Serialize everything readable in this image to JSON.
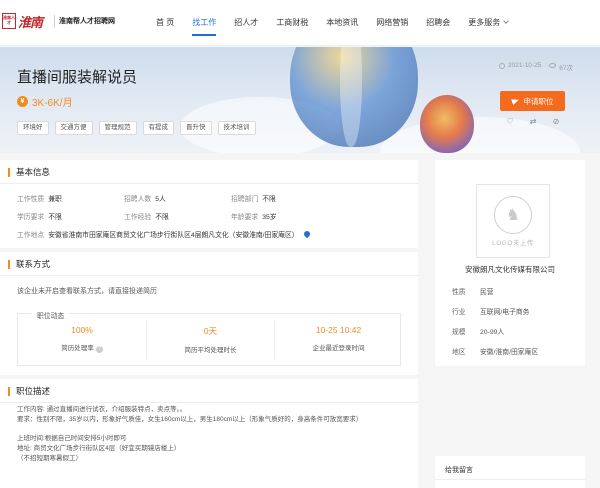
{
  "logo": {
    "seal": "淮南人才",
    "name": "淮南",
    "slogan": "淮南帮人才招聘网"
  },
  "nav": [
    {
      "label": "首 页",
      "active": false
    },
    {
      "label": "找工作",
      "active": true
    },
    {
      "label": "招人才",
      "active": false
    },
    {
      "label": "工商财税",
      "active": false
    },
    {
      "label": "本地资讯",
      "active": false
    },
    {
      "label": "网络营销",
      "active": false
    },
    {
      "label": "招聘会",
      "active": false
    },
    {
      "label": "更多服务",
      "active": false
    }
  ],
  "job": {
    "title": "直播间服装解说员",
    "salary": "3K-6K/月",
    "currency_symbol": "¥",
    "tags": [
      "环境好",
      "交通方便",
      "管理规范",
      "有提成",
      "晋升快",
      "技术培训"
    ],
    "date": "2021-10-25",
    "views": "67次",
    "apply_label": "申请职位"
  },
  "actions": {
    "favorite": "♡",
    "share": "⇄",
    "report": "⊘"
  },
  "basic": {
    "title": "基本信息",
    "rows": [
      [
        {
          "k": "工作性质",
          "v": "兼职"
        },
        {
          "k": "招聘人数",
          "v": "5人"
        },
        {
          "k": "招聘部门",
          "v": "不限"
        }
      ],
      [
        {
          "k": "学历要求",
          "v": "不限"
        },
        {
          "k": "工作经验",
          "v": "不限"
        },
        {
          "k": "年龄要求",
          "v": "35岁"
        }
      ]
    ],
    "address_label": "工作地点",
    "address": "安徽省淮南市田家庵区商贸文化广场步行街队区4层朗凡文化（安徽淮南/田家庵区）"
  },
  "contact": {
    "title": "联系方式",
    "note": "该企业未开启查看联系方式，请直接投递简历",
    "stats_label": "职位动态",
    "stats": [
      {
        "value": "100%",
        "label": "简历处理率"
      },
      {
        "value": "0天",
        "label": "简历平均处理时长"
      },
      {
        "value": "10-25 10:42",
        "label": "企业最近登录时间"
      }
    ],
    "help_glyph": "?"
  },
  "desc": {
    "title": "职位描述",
    "lines": [
      "工作内容: 通过直播间进行试衣，介绍服装特点，卖点等。。",
      "要求：性别不限，35岁以内，形象好气质佳，女生160cm以上，男生180cm以上（形象气质好的，身高条件可放宽要求）",
      "",
      "上班时间:根据自己时间安排5小时即可",
      "地址: 商贸文化广场步行街队区4层（好宜买期镜店楼上）",
      "（不招短期寒暑假工）"
    ]
  },
  "company": {
    "logo_text": "LOGO未上传",
    "name": "安徽朗凡文化传媒有限公司",
    "rows": [
      {
        "k": "性质",
        "v": "民营"
      },
      {
        "k": "行业",
        "v": "互联网/电子商务"
      },
      {
        "k": "规模",
        "v": "20-99人"
      },
      {
        "k": "地区",
        "v": "安徽/淮南/田家庵区"
      }
    ]
  },
  "message": {
    "title": "给我留言"
  }
}
